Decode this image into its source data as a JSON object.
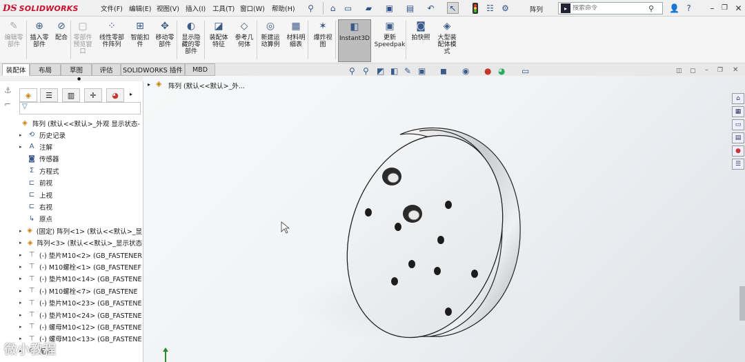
{
  "app": {
    "brand_ds": "DS",
    "brand_name": "SOLIDWORKS"
  },
  "menu": [
    "文件(F)",
    "编辑(E)",
    "视图(V)",
    "插入(I)",
    "工具(T)",
    "窗口(W)",
    "帮助(H)"
  ],
  "toolbar": {
    "document_name": "阵列"
  },
  "search": {
    "placeholder": "搜索命令"
  },
  "ribbon": [
    {
      "label": "编辑零\n部件",
      "icon": "edit-component-icon",
      "disabled": true
    },
    {
      "label": "插入零\n部件",
      "icon": "insert-component-icon"
    },
    {
      "label": "配合",
      "icon": "mate-icon"
    },
    {
      "label": "零部件\n预览窗\n口",
      "icon": "preview-window-icon",
      "disabled": true
    },
    {
      "label": "线性零部\n件阵列",
      "icon": "linear-pattern-icon"
    },
    {
      "label": "智能扣\n件",
      "icon": "smart-fastener-icon"
    },
    {
      "label": "移动零\n部件",
      "icon": "move-component-icon"
    },
    {
      "label": "显示隐\n藏的零\n部件",
      "icon": "show-hidden-icon"
    },
    {
      "label": "装配体\n特征",
      "icon": "assembly-feature-icon"
    },
    {
      "label": "参考几\n何体",
      "icon": "reference-geometry-icon"
    },
    {
      "label": "新建运\n动算例",
      "icon": "new-motion-study-icon"
    },
    {
      "label": "材料明\n细表",
      "icon": "bom-icon"
    },
    {
      "label": "爆炸视\n图",
      "icon": "exploded-view-icon"
    },
    {
      "label": "Instant3D",
      "icon": "instant3d-icon",
      "active": true
    },
    {
      "label": "更新\nSpeedpak",
      "icon": "speedpak-icon"
    },
    {
      "label": "拍快照",
      "icon": "snapshot-icon"
    },
    {
      "label": "大型装\n配体模\n式",
      "icon": "large-assembly-icon"
    }
  ],
  "tabs": [
    "装配体",
    "布局",
    "草图",
    "评估",
    "SOLIDWORKS 插件",
    "MBD"
  ],
  "tree": {
    "root": "阵列  (默认<<默认>_外观 显示状态-",
    "items": [
      {
        "label": "历史记录",
        "icon": "history-icon",
        "expand": true
      },
      {
        "label": "注解",
        "icon": "annotation-icon",
        "expand": true
      },
      {
        "label": "传感器",
        "icon": "sensor-icon"
      },
      {
        "label": "方程式",
        "icon": "equation-icon"
      },
      {
        "label": "前视",
        "icon": "plane-icon"
      },
      {
        "label": "上视",
        "icon": "plane-icon"
      },
      {
        "label": "右视",
        "icon": "plane-icon"
      },
      {
        "label": "原点",
        "icon": "origin-icon"
      },
      {
        "label": "(固定) 阵列<1> (默认<<默认>_显",
        "icon": "subassembly-icon",
        "expand": true
      },
      {
        "label": "阵列<3> (默认<<默认>_显示状态",
        "icon": "subassembly-icon",
        "expand": true
      },
      {
        "label": "(-) 垫片M10<2> (GB_FASTENER",
        "icon": "part-icon",
        "expand": true
      },
      {
        "label": "(-) M10螺栓<1> (GB_FASTENEF",
        "icon": "part-icon",
        "expand": true
      },
      {
        "label": "(-) 垫片M10<14> (GB_FASTENE",
        "icon": "part-icon",
        "expand": true
      },
      {
        "label": "(-) M10螺栓<7> (GB_FASTENE",
        "icon": "part-icon",
        "expand": true
      },
      {
        "label": "(-) 垫片M10<23> (GB_FASTENE",
        "icon": "part-icon",
        "expand": true
      },
      {
        "label": "(-) 垫片M10<24> (GB_FASTENE",
        "icon": "part-icon",
        "expand": true
      },
      {
        "label": "(-) 螺母M10<12> (GB_FASTENE",
        "icon": "part-icon",
        "expand": true
      },
      {
        "label": "(-) 螺母M10<13> (GB_FASTENE",
        "icon": "part-icon",
        "expand": true
      },
      {
        "label": "配合",
        "icon": "mates-icon",
        "expand": true
      }
    ]
  },
  "viewport": {
    "breadcrumb": "阵列  (默认<<默认>_外..."
  },
  "watermark": "微小教程"
}
